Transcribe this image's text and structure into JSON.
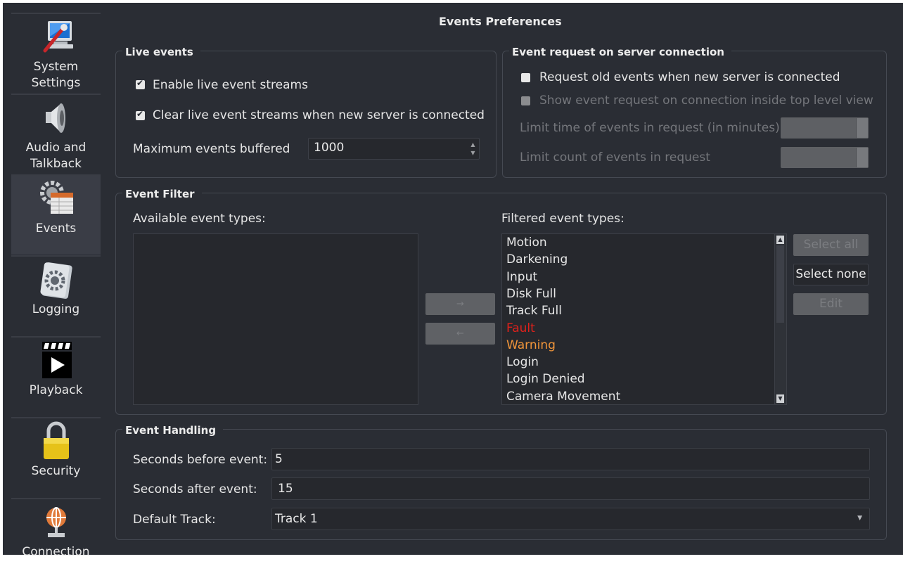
{
  "window": {
    "title": "Events Preferences"
  },
  "sidebar": {
    "items": [
      {
        "label": "System\nSettings",
        "icon": "monitor-wrench-icon",
        "active": false
      },
      {
        "label": "Audio and\nTalkback",
        "icon": "speaker-icon",
        "active": false
      },
      {
        "label": "Events",
        "icon": "gear-table-icon",
        "active": true
      },
      {
        "label": "Logging",
        "icon": "gear-notebook-icon",
        "active": false
      },
      {
        "label": "Playback",
        "icon": "clapperboard-play-icon",
        "active": false
      },
      {
        "label": "Security",
        "icon": "padlock-icon",
        "active": false
      },
      {
        "label": "Connection",
        "icon": "globe-network-icon",
        "active": false
      }
    ]
  },
  "live_events": {
    "title": "Live events",
    "enable_streams": {
      "label": "Enable live event streams",
      "checked": true
    },
    "clear_streams": {
      "label": "Clear live event streams when new server is connected",
      "checked": true
    },
    "max_buffered": {
      "label": "Maximum events buffered",
      "value": "1000"
    }
  },
  "server_request": {
    "title": "Event request on server connection",
    "request_old": {
      "label": "Request old events when new server is connected",
      "checked": false
    },
    "show_request": {
      "label": "Show event request on connection inside top level view",
      "checked": false,
      "disabled": true
    },
    "limit_time": {
      "label": "Limit time of events in request (in minutes)",
      "value": ""
    },
    "limit_count": {
      "label": "Limit count of events in request",
      "value": ""
    }
  },
  "event_filter": {
    "title": "Event Filter",
    "available_label": "Available event types:",
    "filtered_label": "Filtered event types:",
    "available_items": [],
    "filtered_items": [
      {
        "text": "Motion",
        "color": "#e6e6e6"
      },
      {
        "text": "Darkening",
        "color": "#e6e6e6"
      },
      {
        "text": "Input",
        "color": "#e6e6e6"
      },
      {
        "text": "Disk Full",
        "color": "#e6e6e6"
      },
      {
        "text": "Track Full",
        "color": "#e6e6e6"
      },
      {
        "text": "Fault",
        "color": "#e0211b"
      },
      {
        "text": "Warning",
        "color": "#f0953a"
      },
      {
        "text": "Login",
        "color": "#e6e6e6"
      },
      {
        "text": "Login Denied",
        "color": "#e6e6e6"
      },
      {
        "text": "Camera Movement",
        "color": "#e6e6e6"
      }
    ],
    "move_right": "→",
    "move_left": "←",
    "select_all": "Select all",
    "select_none": "Select none",
    "edit": "Edit"
  },
  "event_handling": {
    "title": "Event Handling",
    "seconds_before": {
      "label": "Seconds before event:",
      "value": "5"
    },
    "seconds_after": {
      "label": "Seconds after event:",
      "value": "15"
    },
    "default_track": {
      "label": "Default Track:",
      "value": "Track 1"
    }
  }
}
